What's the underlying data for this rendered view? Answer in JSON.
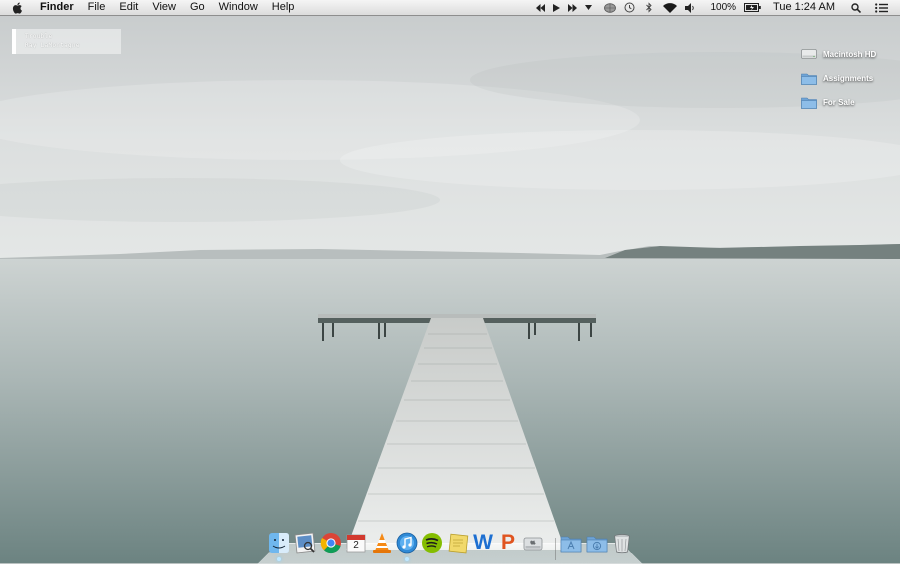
{
  "menubar": {
    "apple_icon": "apple-logo-icon",
    "app_name": "Finder",
    "menus": [
      "File",
      "Edit",
      "View",
      "Go",
      "Window",
      "Help"
    ],
    "status_icons": [
      "rewind-icon",
      "play-icon",
      "fast-forward-icon",
      "dropdown-triangle-icon",
      "network-globe-icon",
      "time-machine-icon",
      "bluetooth-icon",
      "wifi-icon",
      "volume-icon"
    ],
    "battery_percent": "100%",
    "clock": "Tue 1:24 AM",
    "spotlight_icon": "spotlight-search-icon",
    "notification_icon": "notification-center-icon"
  },
  "now_playing": {
    "track": "Trouble",
    "artist": "Ray LaMontagne"
  },
  "desktop_icons": [
    {
      "label": "Macintosh HD",
      "icon": "hard-drive-icon"
    },
    {
      "label": "Assignments",
      "icon": "folder-icon"
    },
    {
      "label": "For Sale",
      "icon": "folder-icon"
    }
  ],
  "dock": {
    "apps": [
      {
        "name": "Finder",
        "icon": "finder-icon",
        "running": true
      },
      {
        "name": "Preview",
        "icon": "preview-icon",
        "running": false
      },
      {
        "name": "Google Chrome",
        "icon": "chrome-icon",
        "running": false
      },
      {
        "name": "Calendar",
        "icon": "calendar-icon",
        "date": "2",
        "running": false
      },
      {
        "name": "VLC",
        "icon": "vlc-cone-icon",
        "running": false
      },
      {
        "name": "iTunes",
        "icon": "itunes-icon",
        "running": true
      },
      {
        "name": "Spotify",
        "icon": "spotify-icon",
        "running": false
      },
      {
        "name": "Stickies",
        "icon": "stickies-icon",
        "running": false
      },
      {
        "name": "Word",
        "icon": "word-icon",
        "letter": "W",
        "running": false
      },
      {
        "name": "PowerPoint",
        "icon": "powerpoint-icon",
        "letter": "P",
        "running": false
      },
      {
        "name": "Boot Camp Assistant",
        "icon": "apple-hardware-icon",
        "running": false
      }
    ],
    "stacks": [
      {
        "name": "Applications",
        "icon": "applications-folder-icon"
      },
      {
        "name": "Downloads",
        "icon": "downloads-folder-icon"
      },
      {
        "name": "Trash",
        "icon": "trash-icon"
      }
    ]
  },
  "colors": {
    "sky_top": "#c9cdcd",
    "sky_bottom": "#e2e5e4",
    "water_top": "#c4cbcb",
    "water_bottom": "#6f8684",
    "dock_wood": "#d9dcd9",
    "folder_blue": "#7fb2e0"
  }
}
